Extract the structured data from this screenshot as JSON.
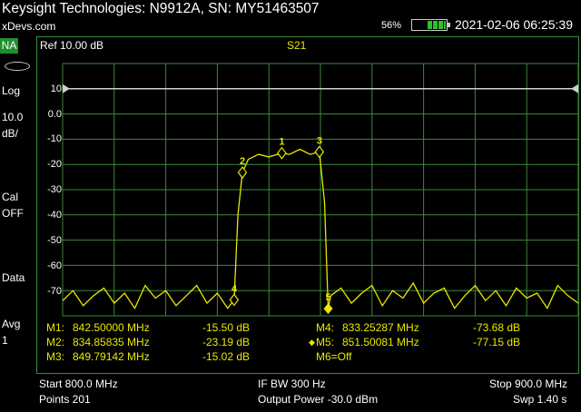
{
  "header": {
    "title": "Keysight Technologies: N9912A, SN: MY51463507",
    "site": "xDevs.com",
    "battery_percent": "56%",
    "battery_level": 0.56,
    "datetime": "2021-02-06 06:25:39"
  },
  "left_panel": {
    "mode": "NA",
    "format": "Log",
    "scale_value": "10.0",
    "scale_unit": "dB/",
    "cal_label": "Cal",
    "cal_state": "OFF",
    "data_label": "Data",
    "avg_label": "Avg",
    "avg_value": "1"
  },
  "plot": {
    "ref_label": "Ref 10.00 dB",
    "trace_name": "S21",
    "y_ticks": [
      "10",
      "0.0",
      "-10",
      "-20",
      "-30",
      "-40",
      "-50",
      "-60",
      "-70"
    ]
  },
  "markers_table": {
    "m1_label": "M1:",
    "m1_freq": "842.50000 MHz",
    "m1_val": "-15.50 dB",
    "m2_label": "M2:",
    "m2_freq": "834.85835 MHz",
    "m2_val": "-23.19 dB",
    "m3_label": "M3:",
    "m3_freq": "849.79142 MHz",
    "m3_val": "-15.02 dB",
    "m4_label": "M4:",
    "m4_freq": "833.25287 MHz",
    "m4_val": "-73.68 dB",
    "m5_label": "M5:",
    "m5_freq": "851.50081 MHz",
    "m5_val": "-77.15 dB",
    "m6_label": "M6=Off"
  },
  "footer": {
    "start": "Start 800.0 MHz",
    "if_bw": "IF BW 300 Hz",
    "stop": "Stop 900.0 MHz",
    "points": "Points 201",
    "power": "Output Power -30.0 dBm",
    "sweep": "Swp 1.40 s"
  },
  "colors": {
    "trace": "#e8e800",
    "grid": "#3a8a3a",
    "mode_badge": "#1f8f2a",
    "battery": "#2fbf2f"
  },
  "chart_data": {
    "type": "line",
    "title": "S21",
    "xlabel": "",
    "ylabel": "",
    "xlim": [
      800.0,
      900.0
    ],
    "ylim": [
      -80,
      20
    ],
    "points": 201,
    "reference_level_db": 10,
    "series": [
      {
        "name": "S21",
        "x": [
          800,
          802,
          804,
          806,
          808,
          810,
          812,
          814,
          816,
          818,
          820,
          822,
          824,
          826,
          828,
          830,
          832,
          833.25,
          834,
          834.86,
          836,
          838,
          840,
          842.5,
          844,
          846,
          848,
          849.79,
          850.8,
          851.5,
          852,
          854,
          856,
          858,
          860,
          862,
          864,
          866,
          868,
          870,
          872,
          874,
          876,
          878,
          880,
          882,
          884,
          886,
          888,
          890,
          892,
          894,
          896,
          898,
          900
        ],
        "y": [
          -74,
          -70,
          -76,
          -72,
          -69,
          -75,
          -71,
          -77,
          -68,
          -73,
          -70,
          -76,
          -72,
          -68,
          -75,
          -71,
          -77,
          -73.68,
          -40,
          -23.19,
          -18,
          -16,
          -17,
          -15.5,
          -16,
          -14,
          -16,
          -15.02,
          -35,
          -77.15,
          -72,
          -69,
          -75,
          -71,
          -68,
          -76,
          -70,
          -73,
          -67,
          -75,
          -71,
          -69,
          -77,
          -72,
          -68,
          -74,
          -70,
          -76,
          -69,
          -73,
          -71,
          -77,
          -68,
          -72,
          -75
        ]
      }
    ],
    "markers": [
      {
        "id": "1",
        "x": 842.5,
        "y": -15.5
      },
      {
        "id": "2",
        "x": 834.85835,
        "y": -23.19
      },
      {
        "id": "3",
        "x": 849.79142,
        "y": -15.02
      },
      {
        "id": "4",
        "x": 833.25287,
        "y": -73.68
      },
      {
        "id": "5",
        "x": 851.50081,
        "y": -77.15,
        "active": true
      }
    ]
  }
}
